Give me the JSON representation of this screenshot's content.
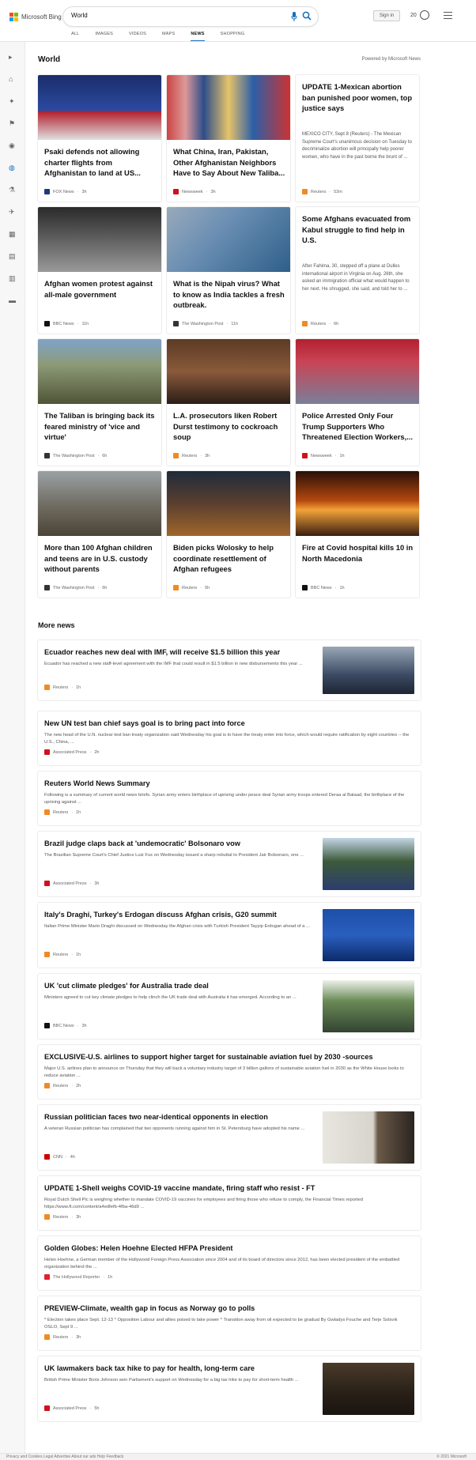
{
  "header": {
    "brand": "Microsoft Bing",
    "search_value": "World",
    "sign_in": "Sign in",
    "rewards_count": "20",
    "tabs": [
      {
        "label": "ALL",
        "active": false
      },
      {
        "label": "IMAGES",
        "active": false
      },
      {
        "label": "VIDEOS",
        "active": false
      },
      {
        "label": "MAPS",
        "active": false
      },
      {
        "label": "NEWS",
        "active": true
      },
      {
        "label": "SHOPPING",
        "active": false
      }
    ]
  },
  "rail_icons": [
    "collapse-icon",
    "home-icon",
    "discover-icon",
    "flag-icon",
    "local-pin-icon",
    "world-globe-icon",
    "science-icon",
    "sports-icon",
    "movie-icon",
    "money-icon",
    "entertainment-icon",
    "tv-icon"
  ],
  "world": {
    "title": "World",
    "powered_by": "Powered by Microsoft News",
    "cards": [
      {
        "title": "Psaki defends not allowing charter flights from Afghanistan to land at US...",
        "source": "FOX News",
        "age": "3h",
        "color": "#1d3a7a"
      },
      {
        "title": "What China, Iran, Pakistan, Other Afghanistan Neighbors Have to Say About New Taliba...",
        "source": "Newsweek",
        "age": "3h",
        "color": "#d0111b"
      },
      {
        "title": "UPDATE 1-Mexican abortion ban punished poor women, top justice says",
        "snippet": "MEXICO CITY, Sept 8 (Reuters) - The Mexican Supreme Court's unanimous decision on Tuesday to decriminalize abortion will principally help poorer women, who have in the past borne the brunt of ...",
        "source": "Reuters",
        "age": "53m",
        "color": "#f08a24"
      },
      {
        "title": "Afghan women protest against all-male government",
        "source": "BBC News",
        "age": "11h",
        "color": "#111111"
      },
      {
        "title": "What is the Nipah virus? What to know as India tackles a fresh outbreak.",
        "source": "The Washington Post",
        "age": "11h",
        "color": "#333333"
      },
      {
        "title": "Some Afghans evacuated from Kabul struggle to find help in U.S.",
        "snippet": "After Fahima, 30, stepped off a plane at Dulles international airport in Virginia on Aug. 26th, she asked an immigration official what would happen to her next. He shrugged, she said, and told her to ...",
        "source": "Reuters",
        "age": "6h",
        "color": "#f08a24"
      },
      {
        "title": "The Taliban is bringing back its feared ministry of 'vice and virtue'",
        "source": "The Washington Post",
        "age": "6h",
        "color": "#333333"
      },
      {
        "title": "L.A. prosecutors liken Robert Durst testimony to cockroach soup",
        "source": "Reuters",
        "age": "3h",
        "color": "#f08a24"
      },
      {
        "title": "Police Arrested Only Four Trump Supporters Who Threatened Election Workers,...",
        "source": "Newsweek",
        "age": "1h",
        "color": "#d0111b"
      },
      {
        "title": "More than 100 Afghan children and teens are in U.S. custody without parents",
        "source": "The Washington Post",
        "age": "6h",
        "color": "#333333"
      },
      {
        "title": "Biden picks Wolosky to help coordinate resettlement of Afghan refugees",
        "source": "Reuters",
        "age": "5h",
        "color": "#f08a24"
      },
      {
        "title": "Fire at Covid hospital kills 10 in North Macedonia",
        "source": "BBC News",
        "age": "1h",
        "color": "#111111"
      }
    ]
  },
  "more_news": {
    "title": "More news",
    "items": [
      {
        "title": "Ecuador reaches new deal with IMF, will receive $1.5 billion this year",
        "snippet": "Ecuador has reached a new staff-level agreement with the IMF that could result in $1.5 billion in new disbursements this year ...",
        "source": "Reuters",
        "age": "1h",
        "color": "#f08a24"
      },
      {
        "title": "New UN test ban chief says goal is to bring pact into force",
        "snippet": "The new head of the U.N. nuclear test ban treaty organization said Wednesday his goal is to have the treaty enter into force, which would require ratification by eight countries -- the U.S., China, ...",
        "source": "Associated Press",
        "age": "2h",
        "color": "#d0111b"
      },
      {
        "title": "Reuters World News Summary",
        "snippet": "Following is a summary of current world news briefs. Syrian army enters birthplace of uprising under peace deal Syrian army troops entered Deraa al Balaad, the birthplace of the uprising against ...",
        "source": "Reuters",
        "age": "1h",
        "color": "#f08a24"
      },
      {
        "title": "Brazil judge claps back at 'undemocratic' Bolsonaro vow",
        "snippet": "The Brazilian Supreme Court's Chief Justice Luiz Fux on Wednesday issued a sharp rebuttal to President Jair Bolsonaro, one ...",
        "source": "Associated Press",
        "age": "3h",
        "color": "#d0111b"
      },
      {
        "title": "Italy's Draghi, Turkey's Erdogan discuss Afghan crisis, G20 summit",
        "snippet": "Italian Prime Minister Mario Draghi discussed on Wednesday the Afghan crisis with Turkish President Tayyip Erdogan ahead of a ...",
        "source": "Reuters",
        "age": "1h",
        "color": "#f08a24"
      },
      {
        "title": "UK 'cut climate pledges' for Australia trade deal",
        "snippet": "Ministers agreed to cut key climate pledges to help clinch the UK trade deal with Australia it has emerged. According to an ...",
        "source": "BBC News",
        "age": "3h",
        "color": "#111111"
      },
      {
        "title": "EXCLUSIVE-U.S. airlines to support higher target for sustainable aviation fuel by 2030 -sources",
        "snippet": "Major U.S. airlines plan to announce on Thursday that they will back a voluntary industry target of 3 billion gallons of sustainable aviation fuel in 2030 as the White House looks to reduce aviation ...",
        "source": "Reuters",
        "age": "2h",
        "color": "#f08a24"
      },
      {
        "title": "Russian politician faces two near-identical opponents in election",
        "snippet": "A veteran Russian politician has complained that two opponents running against him in St. Petersburg have adopted his name ...",
        "source": "CNN",
        "age": "4h",
        "color": "#cc0000"
      },
      {
        "title": "UPDATE 1-Shell weighs COVID-19 vaccine mandate, firing staff who resist - FT",
        "snippet": "Royal Dutch Shell Plc is weighing whether to mandate COVID-19 vaccines for employees and firing those who refuse to comply, the Financial Times reported https://www.ft.com/content/a4edfefb-4fba-46d9 ...",
        "source": "Reuters",
        "age": "3h",
        "color": "#f08a24"
      },
      {
        "title": "Golden Globes: Helen Hoehne Elected HFPA President",
        "snippet": "Helen Hoehne, a German member of the Hollywood Foreign Press Association since 2004 and of its board of directors since 2012, has been elected president of the embattled organization behind the ...",
        "source": "The Hollywood Reporter",
        "age": "1h",
        "color": "#e0202e"
      },
      {
        "title": "PREVIEW-Climate, wealth gap in focus as Norway go to polls",
        "snippet": "* Election takes place Sept. 12-13 * Opposition Labour and allies poised to take power * Transition away from oil expected to be gradual By Gwladys Fouche and Terje Solsvik OSLO, Sept 9 ...",
        "source": "Reuters",
        "age": "3h",
        "color": "#f08a24"
      },
      {
        "title": "UK lawmakers back tax hike to pay for health, long-term care",
        "snippet": "British Prime Minister Boris Johnson won Parliament's support on Wednesday for a big tax hike to pay for short-term health ...",
        "source": "Associated Press",
        "age": "5h",
        "color": "#d0111b"
      }
    ]
  },
  "footer": {
    "left": "Privacy and Cookies  Legal  Advertise  About our ads  Help  Feedback",
    "right": "© 2021 Microsoft"
  }
}
